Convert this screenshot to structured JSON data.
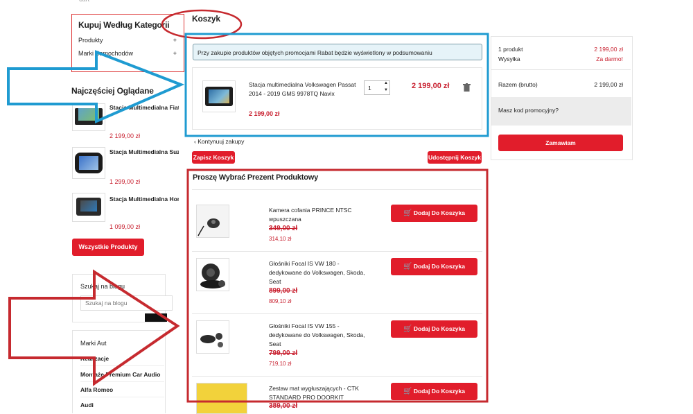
{
  "sidebar": {
    "categories_title": "Kupuj Według Kategorii",
    "categories": [
      {
        "label": "Produkty",
        "toggle": "+"
      },
      {
        "label": "Marki Samochodów",
        "toggle": "+"
      }
    ],
    "recently_viewed_title": "Najczęściej Oglądane",
    "recent_products": [
      {
        "name": "Stacja Multimedialna Fiat...",
        "price": "2 199,00 zł"
      },
      {
        "name": "Stacja Multimedialna Suzuki...",
        "price": "1 299,00 zł"
      },
      {
        "name": "Stacja Multimedialna Honda...",
        "price": "1 099,00 zł"
      }
    ],
    "all_products_button": "Wszystkie Produkty",
    "blog_search_title": "Szukaj na blogu",
    "blog_search_placeholder": "Szukaj na blogu",
    "brands_title": "Marki Aut",
    "brands": [
      "Realizacje",
      "Montaże Premium Car Audio",
      "Alfa Romeo",
      "Audi"
    ]
  },
  "cart": {
    "title": "Koszyk",
    "promo_notice": "Przy zakupie produktów objętych promocjami Rabat będzie wyświetlony w podsumowaniu",
    "item": {
      "name": "Stacja multimedialna Volkswagen Passat 2014 - 2019 GMS 9978TQ Navix",
      "unit_price": "2 199,00 zł",
      "quantity": "1",
      "total": "2 199,00 zł"
    },
    "continue_shopping": "Kontynuuj zakupy",
    "save_cart": "Zapisz Koszyk",
    "share_cart": "Udostępnij Koszyk"
  },
  "summary": {
    "count_label": "1 produkt",
    "count_value": "2 199,00 zł",
    "shipping_label": "Wysyłka",
    "shipping_value": "Za darmo!",
    "total_label": "Razem (brutto)",
    "total_value": "2 199,00 zł",
    "promo_code": "Masz kod promocyjny?",
    "order_button": "Zamawiam"
  },
  "gifts": {
    "title": "Proszę Wybrać Prezent Produktowy",
    "add_label": "Dodaj Do Koszyka",
    "items": [
      {
        "name": "Kamera cofania PRINCE NTSC wpuszczana",
        "old_price": "349,00 zł",
        "price": "314,10 zł"
      },
      {
        "name": "Głośniki Focal IS VW 180 - dedykowane do Volkswagen, Skoda, Seat",
        "old_price": "899,00 zł",
        "price": "809,10 zł"
      },
      {
        "name": "Głośniki Focal IS VW 155 - dedykowane do Volkswagen, Skoda, Seat",
        "old_price": "799,00 zł",
        "price": "719,10 zł"
      },
      {
        "name": "Zestaw mat wygłuszających - CTK STANDARD PRO DOORKIT",
        "old_price": "389,00 zł",
        "price": ""
      }
    ]
  },
  "colors": {
    "accent": "#e11d2b",
    "annotation_blue": "#1f9bd1",
    "annotation_red": "#c62a2f"
  }
}
